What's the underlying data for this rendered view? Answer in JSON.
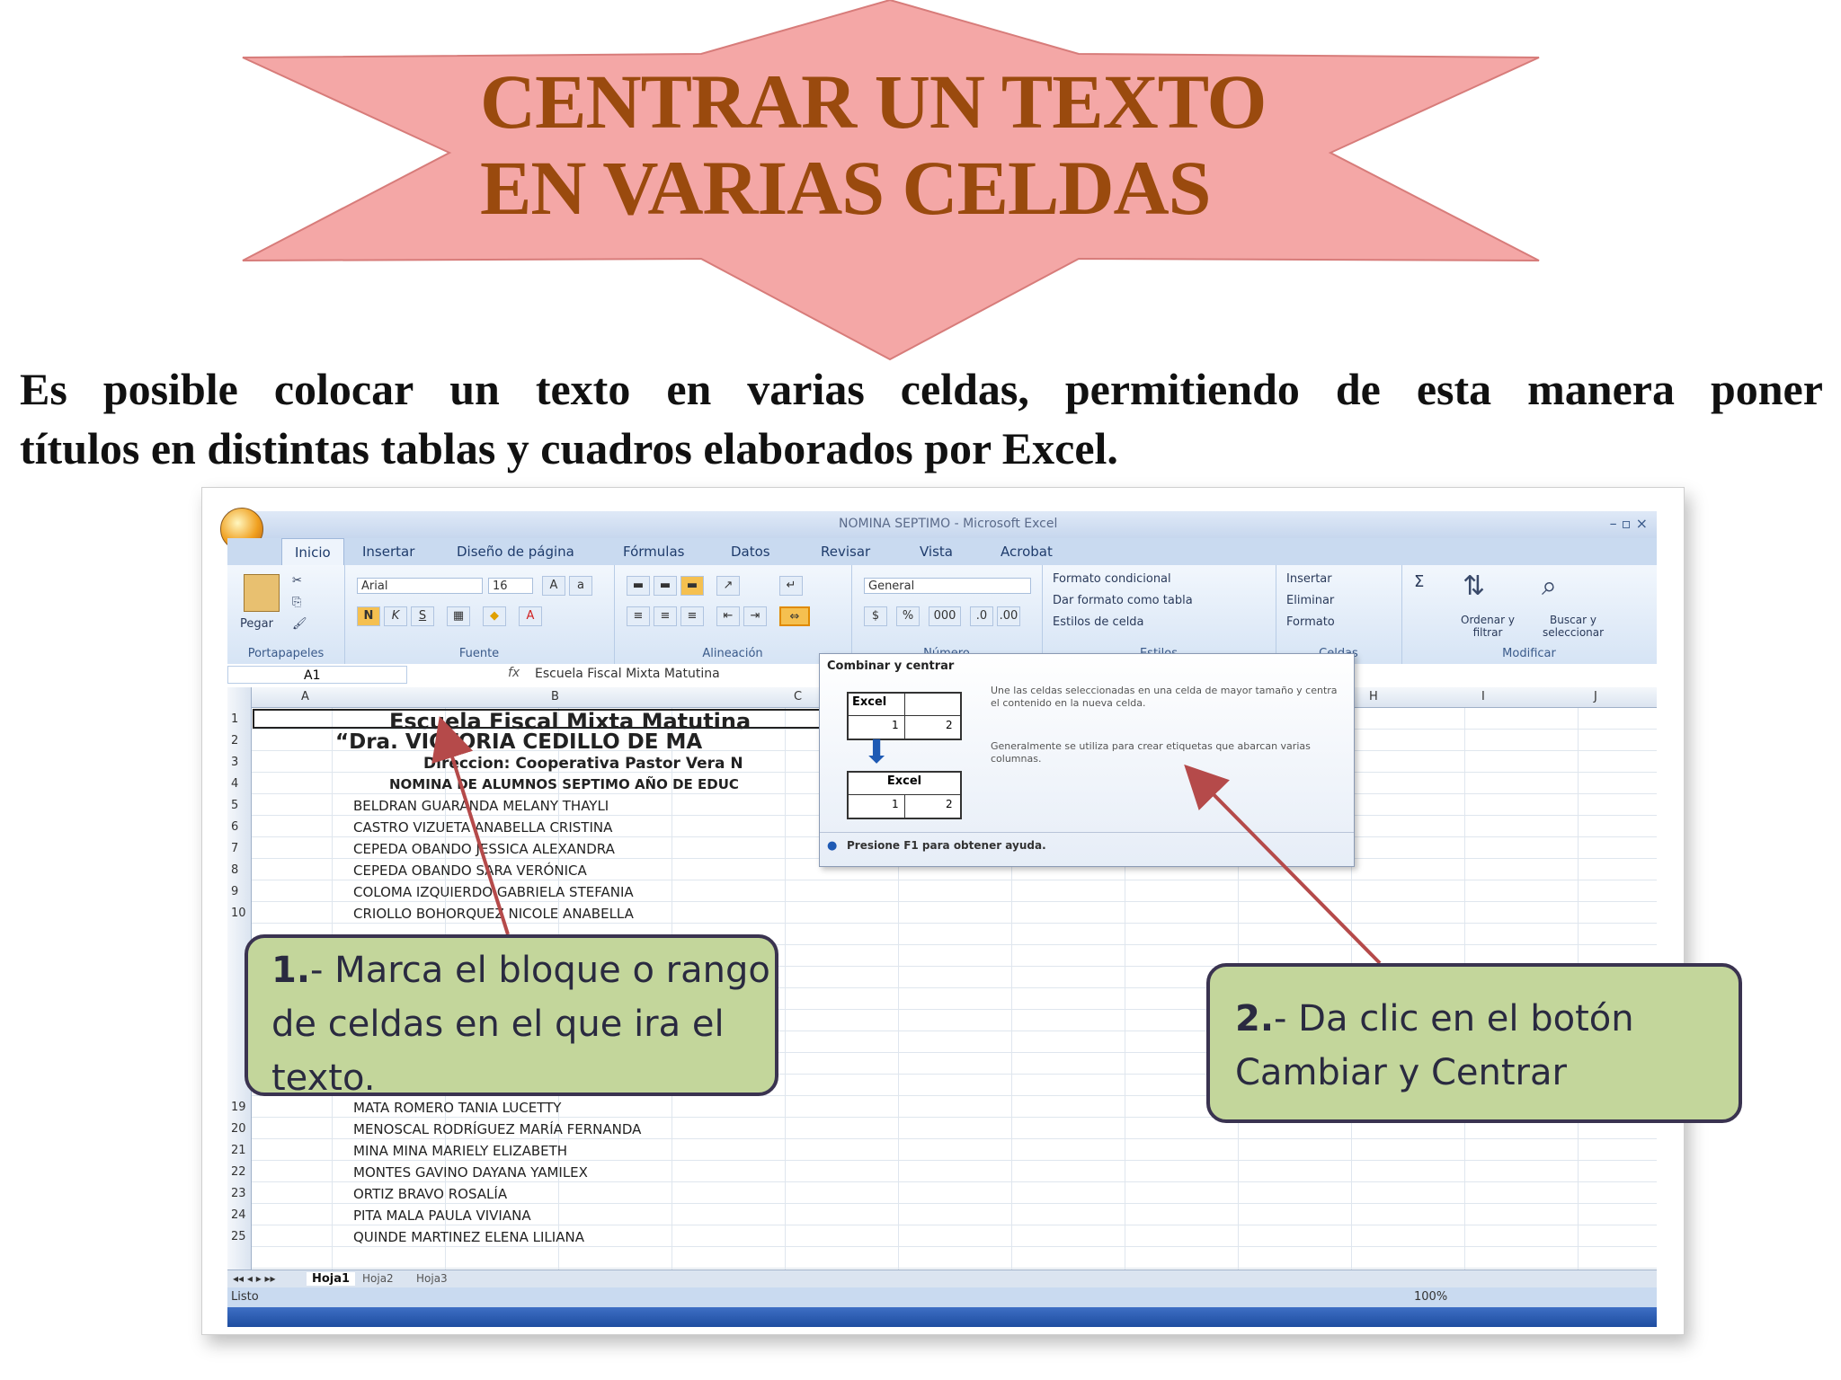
{
  "banner": {
    "title_line1": "CENTRAR UN TEXTO",
    "title_line2": "EN VARIAS CELDAS",
    "star_fill": "#f4a7a6",
    "title_color": "#9a4a0e"
  },
  "intro": {
    "line1_words": [
      "Es",
      "posible",
      "colocar",
      "un",
      "texto",
      "en",
      "varias",
      "celdas,",
      "permitiendo",
      "de",
      "esta",
      "manera",
      "poner"
    ],
    "line2": "títulos en distintas tablas y cuadros elaborados por Excel."
  },
  "excel": {
    "window_title": "NOMINA SEPTIMO - Microsoft Excel",
    "tabs": [
      "Inicio",
      "Insertar",
      "Diseño de página",
      "Fórmulas",
      "Datos",
      "Revisar",
      "Vista",
      "Acrobat"
    ],
    "ribbon": {
      "paste_label": "Pegar",
      "clipboard_group": "Portapapeles",
      "font_name": "Arial",
      "font_size": "16",
      "font_group": "Fuente",
      "alignment_group": "Alineación",
      "number_format": "General",
      "number_group": "Número",
      "styles": [
        "Formato condicional",
        "Dar formato como tabla",
        "Estilos de celda"
      ],
      "styles_group": "Estilos",
      "cells": [
        "Insertar",
        "Eliminar",
        "Formato"
      ],
      "cells_group": "Celdas",
      "sort_label": "Ordenar y filtrar",
      "find_label": "Buscar y seleccionar",
      "modify_group": "Modificar"
    },
    "name_box": "A1",
    "formula_value": "Escuela Fiscal Mixta Matutina",
    "columns": [
      "A",
      "B",
      "C",
      "H",
      "I",
      "J"
    ],
    "rows": [
      {
        "n": "1",
        "text": "Escuela Fiscal Mixta Matutina"
      },
      {
        "n": "2",
        "text": "“Dra. VICTORIA CEDILLO DE MA"
      },
      {
        "n": "3",
        "text": "Direccion: Cooperativa Pastor Vera N"
      },
      {
        "n": "4",
        "text": "NOMINA DE ALUMNOS SEPTIMO AÑO DE EDUC"
      },
      {
        "n": "5",
        "text": "BELDRAN GUARANDA MELANY THAYLI"
      },
      {
        "n": "6",
        "text": "CASTRO VIZUETA ANABELLA CRISTINA"
      },
      {
        "n": "7",
        "text": "CEPEDA OBANDO JESSICA ALEXANDRA"
      },
      {
        "n": "8",
        "text": "CEPEDA OBANDO SARA VERÓNICA"
      },
      {
        "n": "9",
        "text": "COLOMA IZQUIERDO GABRIELA STEFANIA"
      },
      {
        "n": "10",
        "text": "CRIOLLO BOHORQUEZ NICOLE ANABELLA"
      },
      {
        "n": "19",
        "text": "MATA ROMERO TANIA LUCETTY"
      },
      {
        "n": "20",
        "text": "MENOSCAL RODRÍGUEZ MARÍA FERNANDA"
      },
      {
        "n": "21",
        "text": "MINA MINA MARIELY ELIZABETH"
      },
      {
        "n": "22",
        "text": "MONTES GAVINO DAYANA YAMILEX"
      },
      {
        "n": "23",
        "text": "ORTIZ BRAVO ROSALÍA"
      },
      {
        "n": "24",
        "text": "PITA MALA PAULA VIVIANA"
      },
      {
        "n": "25",
        "text": "QUINDE MARTINEZ ELENA LILIANA"
      }
    ],
    "sheet_tabs": [
      "Hoja1",
      "Hoja2",
      "Hoja3"
    ],
    "status": "Listo",
    "zoom": "100%",
    "tooltip": {
      "title": "Combinar y centrar",
      "body1": "Une las celdas seleccionadas en una celda de mayor tamaño y centra el contenido en la nueva celda.",
      "body2": "Generalmente se utiliza para crear etiquetas que abarcan varias columnas.",
      "help": "Presione F1 para obtener ayuda.",
      "demo_label": "Excel",
      "demo_cells": [
        "1",
        "2"
      ]
    }
  },
  "callouts": {
    "step1_num": "1.",
    "step1_text": "- Marca el bloque o rango de celdas en el que ira el texto.",
    "step2_num": "2.",
    "step2_text": "- Da clic en el botón Cambiar y Centrar",
    "fill": "#c3d69b",
    "arrow_color": "#b54a4a"
  }
}
